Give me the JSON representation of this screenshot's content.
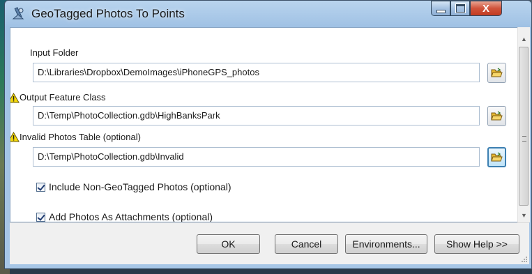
{
  "window": {
    "title": "GeoTagged Photos To Points",
    "controls": {
      "minimize": "minimize",
      "maximize": "maximize",
      "close": "X"
    }
  },
  "form": {
    "input_folder": {
      "label": "Input Folder",
      "value": "D:\\Libraries\\Dropbox\\DemoImages\\iPhoneGPS_photos"
    },
    "output_feature_class": {
      "label": "Output Feature Class",
      "value": "D:\\Temp\\PhotoCollection.gdb\\HighBanksPark",
      "warning": true
    },
    "invalid_photos_table": {
      "label": "Invalid Photos Table (optional)",
      "value": "D:\\Temp\\PhotoCollection.gdb\\Invalid",
      "warning": true
    },
    "include_non_geotagged": {
      "label": "Include Non-GeoTagged Photos (optional)",
      "checked": true
    },
    "add_photos_as_attachments": {
      "label": "Add Photos As Attachments (optional)",
      "checked": true
    }
  },
  "buttons": {
    "ok": "OK",
    "cancel": "Cancel",
    "environments": "Environments...",
    "show_help": "Show Help >>"
  },
  "icons": {
    "app": "geoprocessing-tool-icon",
    "warning": "warning-triangle-icon",
    "browse": "open-folder-icon"
  },
  "colors": {
    "titlebar": "#a7c6e6",
    "close_button": "#c23b22",
    "warning": "#f5d90a",
    "folder": "#e8b830"
  }
}
